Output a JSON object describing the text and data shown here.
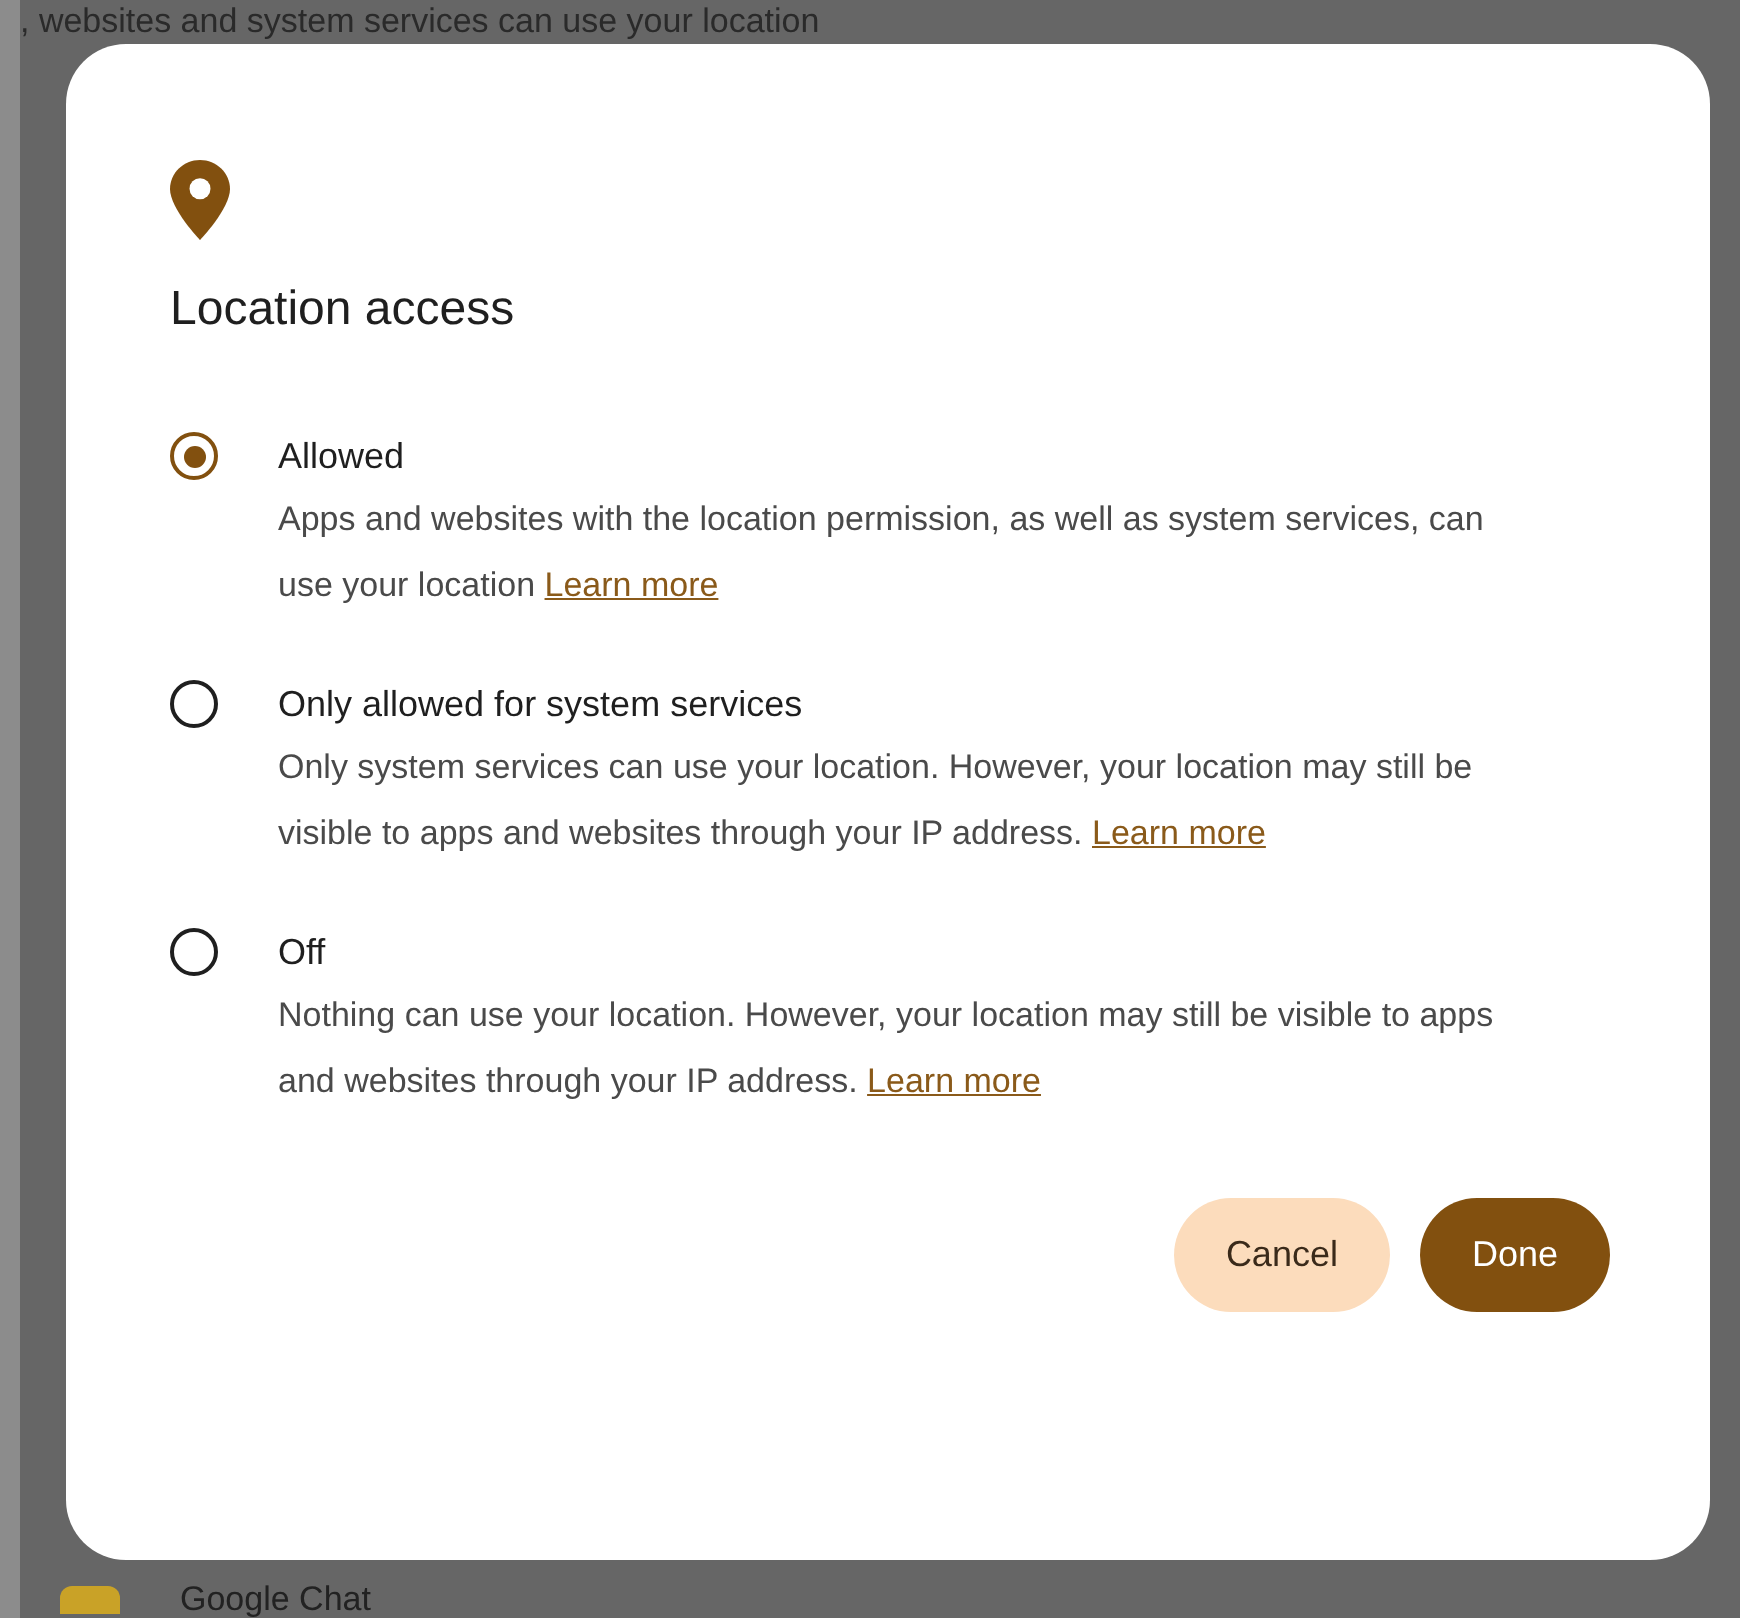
{
  "background": {
    "top_text": ", websites and system services can use your location",
    "bottom_text": "Google Chat"
  },
  "dialog": {
    "title": "Location access",
    "options": [
      {
        "label": "Allowed",
        "description": "Apps and websites with the location permission, as well as system services, can use your location",
        "link": "Learn more",
        "selected": true
      },
      {
        "label": "Only allowed for system services",
        "description": "Only system services can use your location. However, your location may still be visible to apps and websites through your IP address.",
        "link": "Learn more",
        "selected": false
      },
      {
        "label": "Off",
        "description": "Nothing can use your location. However, your location may still be visible to apps and websites through your IP address.",
        "link": "Learn more",
        "selected": false
      }
    ],
    "buttons": [
      {
        "label": "Cancel",
        "kind": "secondary"
      },
      {
        "label": "Done",
        "kind": "primary"
      }
    ]
  }
}
